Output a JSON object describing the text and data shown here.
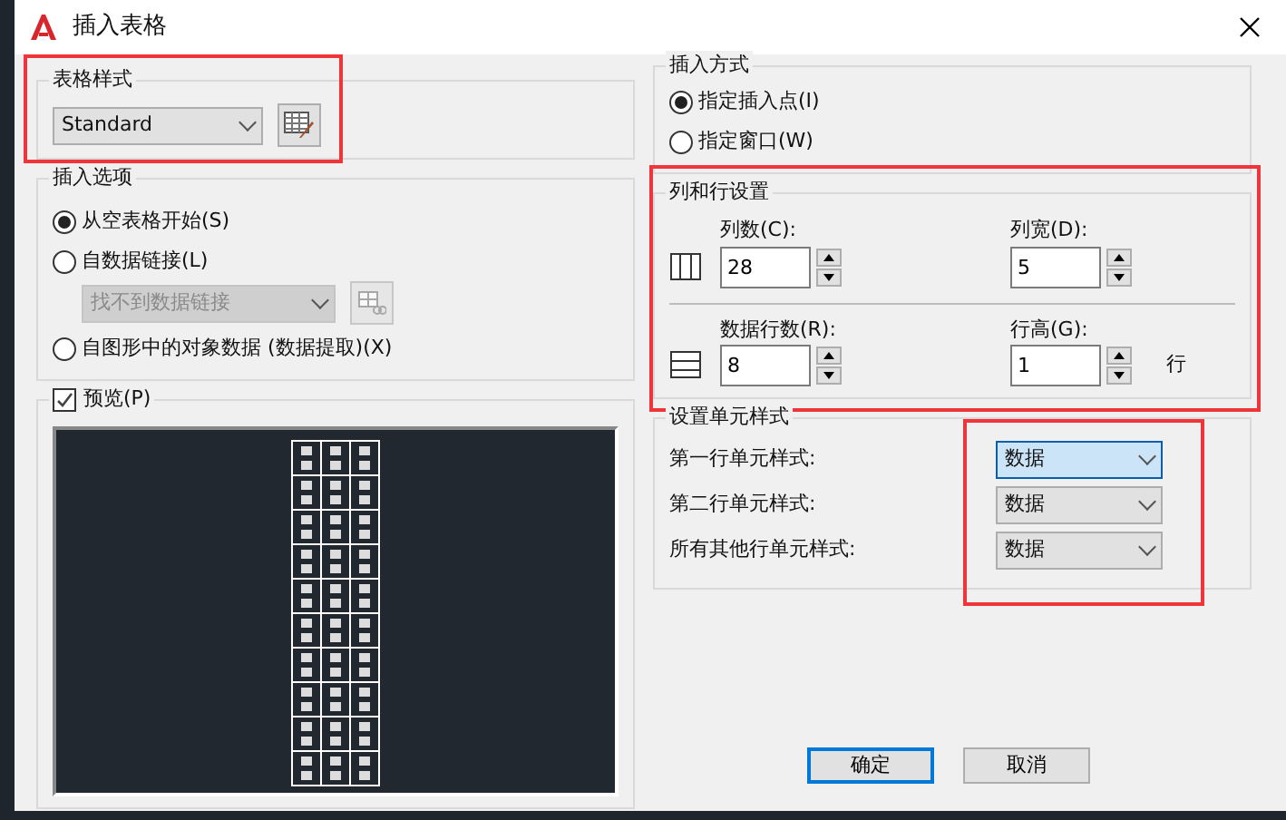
{
  "window": {
    "title": "插入表格"
  },
  "table_style": {
    "label": "表格样式",
    "value": "Standard",
    "highlighted": true
  },
  "insert_options": {
    "label": "插入选项",
    "options": [
      {
        "label": "从空表格开始(S)",
        "selected": true
      },
      {
        "label": "自数据链接(L)",
        "selected": false
      },
      {
        "label": "自图形中的对象数据 (数据提取)(X)",
        "selected": false
      }
    ],
    "data_link": {
      "value": "找不到数据链接",
      "disabled": true
    }
  },
  "preview": {
    "label": "预览(P)",
    "checked": true
  },
  "insert_method": {
    "label": "插入方式",
    "options": [
      {
        "label": "指定插入点(I)",
        "selected": true
      },
      {
        "label": "指定窗口(W)",
        "selected": false
      }
    ]
  },
  "row_column_settings": {
    "label": "列和行设置",
    "highlighted": true,
    "fields": [
      {
        "label": "列数(C):",
        "value": "28"
      },
      {
        "label": "列宽(D):",
        "value": "5"
      },
      {
        "label": "数据行数(R):",
        "value": "8"
      },
      {
        "label": "行高(G):",
        "value": "1",
        "unit": "行"
      }
    ]
  },
  "cell_styles": {
    "label": "设置单元样式",
    "highlighted": true,
    "rows": [
      {
        "label": "第一行单元样式:",
        "value": "数据",
        "focused": true
      },
      {
        "label": "第二行单元样式:",
        "value": "数据",
        "focused": false
      },
      {
        "label": "所有其他行单元样式:",
        "value": "数据",
        "focused": false
      }
    ]
  },
  "buttons": [
    {
      "label": "确定",
      "default": true
    },
    {
      "label": "取消",
      "default": false
    }
  ]
}
